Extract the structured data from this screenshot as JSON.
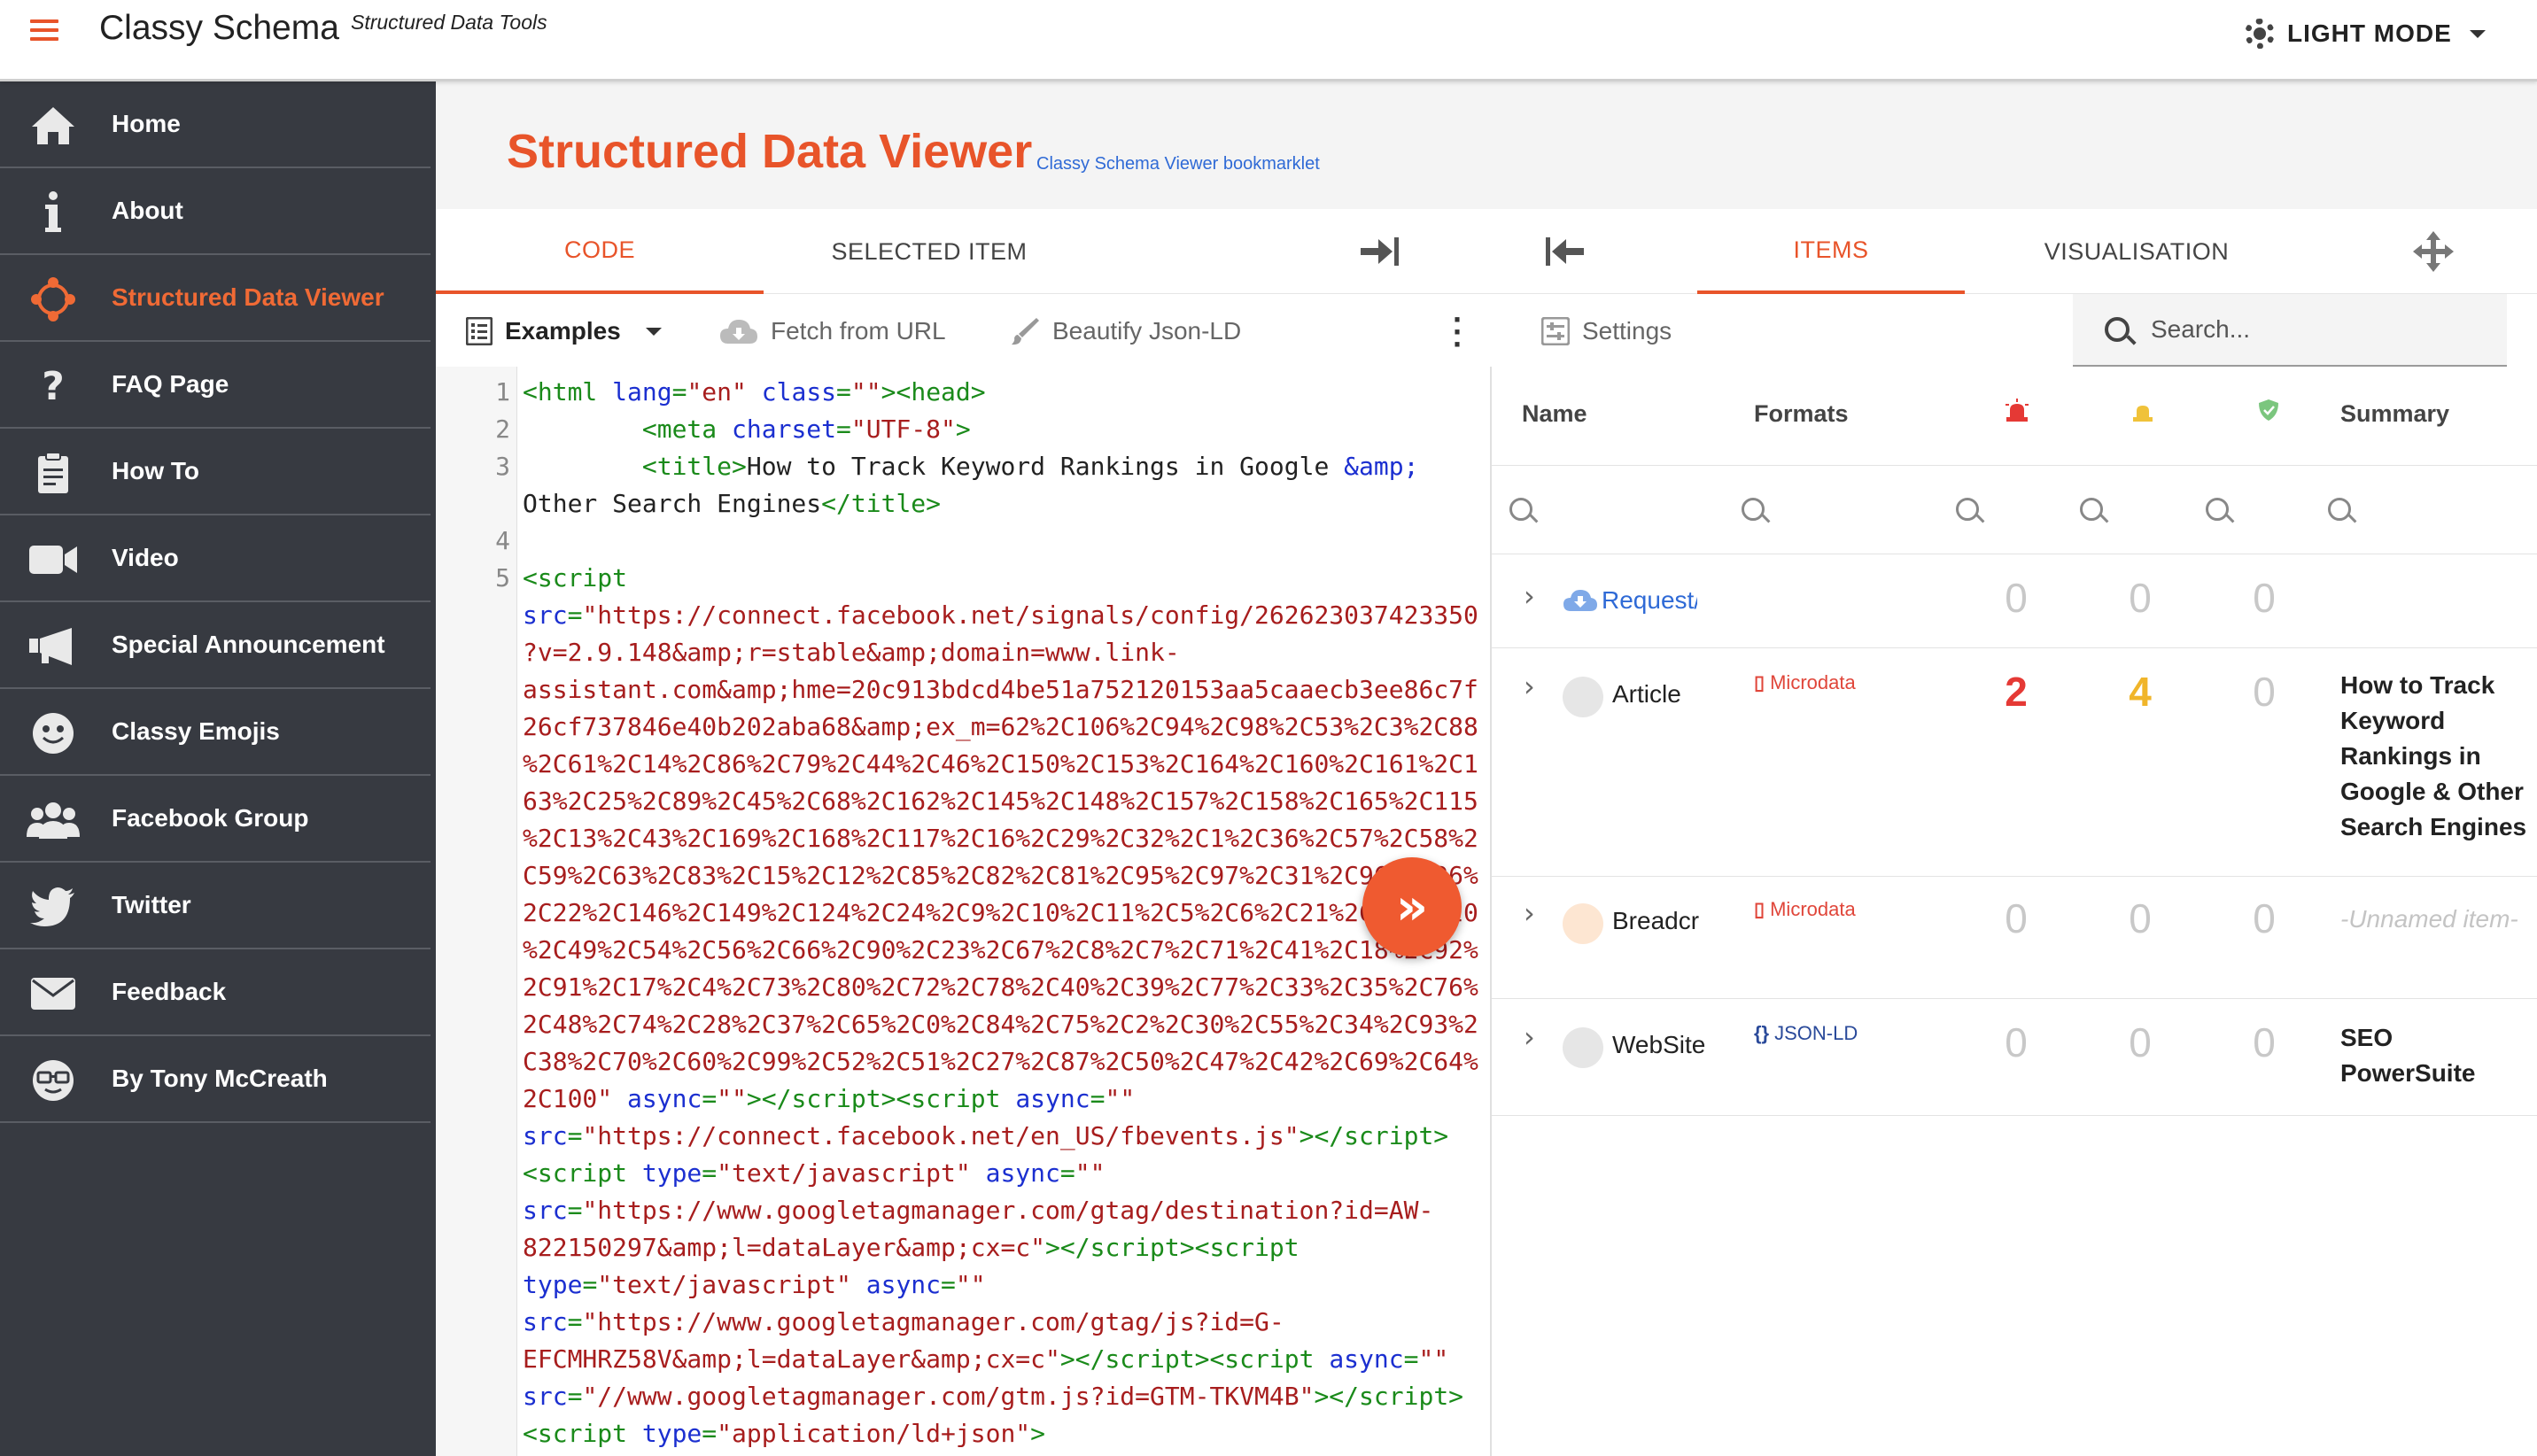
{
  "app": {
    "title": "Classy Schema",
    "subtitle": "Structured Data Tools",
    "mode_label": "LIGHT MODE"
  },
  "sidebar": {
    "items": [
      {
        "label": "Home",
        "icon": "home-icon"
      },
      {
        "label": "About",
        "icon": "info-icon"
      },
      {
        "label": "Structured Data Viewer",
        "icon": "network-icon",
        "active": true
      },
      {
        "label": "FAQ Page",
        "icon": "question-icon"
      },
      {
        "label": "How To",
        "icon": "clipboard-icon"
      },
      {
        "label": "Video",
        "icon": "video-camera-icon"
      },
      {
        "label": "Special Announcement",
        "icon": "megaphone-icon"
      },
      {
        "label": "Classy Emojis",
        "icon": "emoji-icon"
      },
      {
        "label": "Facebook Group",
        "icon": "group-icon"
      },
      {
        "label": "Twitter",
        "icon": "twitter-icon"
      },
      {
        "label": "Feedback",
        "icon": "envelope-icon"
      },
      {
        "label": "By Tony McCreath",
        "icon": "nerd-face-icon"
      }
    ]
  },
  "main": {
    "title": "Structured Data Viewer",
    "link": "Classy Schema Viewer bookmarklet"
  },
  "tabs": {
    "code": "CODE",
    "selected_item": "SELECTED ITEM",
    "items": "ITEMS",
    "visualisation": "VISUALISATION"
  },
  "toolbar": {
    "examples": "Examples",
    "fetch": "Fetch from URL",
    "beautify": "Beautify Json-LD",
    "settings": "Settings",
    "search_placeholder": "Search..."
  },
  "code": {
    "line_numbers": [
      "1",
      "2",
      "3",
      "4",
      "5"
    ]
  },
  "items_table": {
    "headers": {
      "name": "Name",
      "formats": "Formats",
      "summary": "Summary"
    },
    "rows": [
      {
        "name": "Request/",
        "format": "",
        "errors": "0",
        "warnings": "0",
        "valid": "0",
        "summary": ""
      },
      {
        "name": "Article",
        "format": "Microdata",
        "errors": "2",
        "warnings": "4",
        "valid": "0",
        "summary": "How to Track Keyword Rankings in Google & Other Search Engines"
      },
      {
        "name": "Breadcr",
        "format": "Microdata",
        "errors": "0",
        "warnings": "0",
        "valid": "0",
        "summary": "-Unnamed item-"
      },
      {
        "name": "WebSite",
        "format": "JSON-LD",
        "errors": "0",
        "warnings": "0",
        "valid": "0",
        "summary": "SEO PowerSuite"
      }
    ]
  },
  "colors": {
    "accent": "#e8542a",
    "sidebar_bg": "#373a41",
    "error": "#e53935",
    "warning": "#f0b52a",
    "valid": "#4caf50"
  }
}
